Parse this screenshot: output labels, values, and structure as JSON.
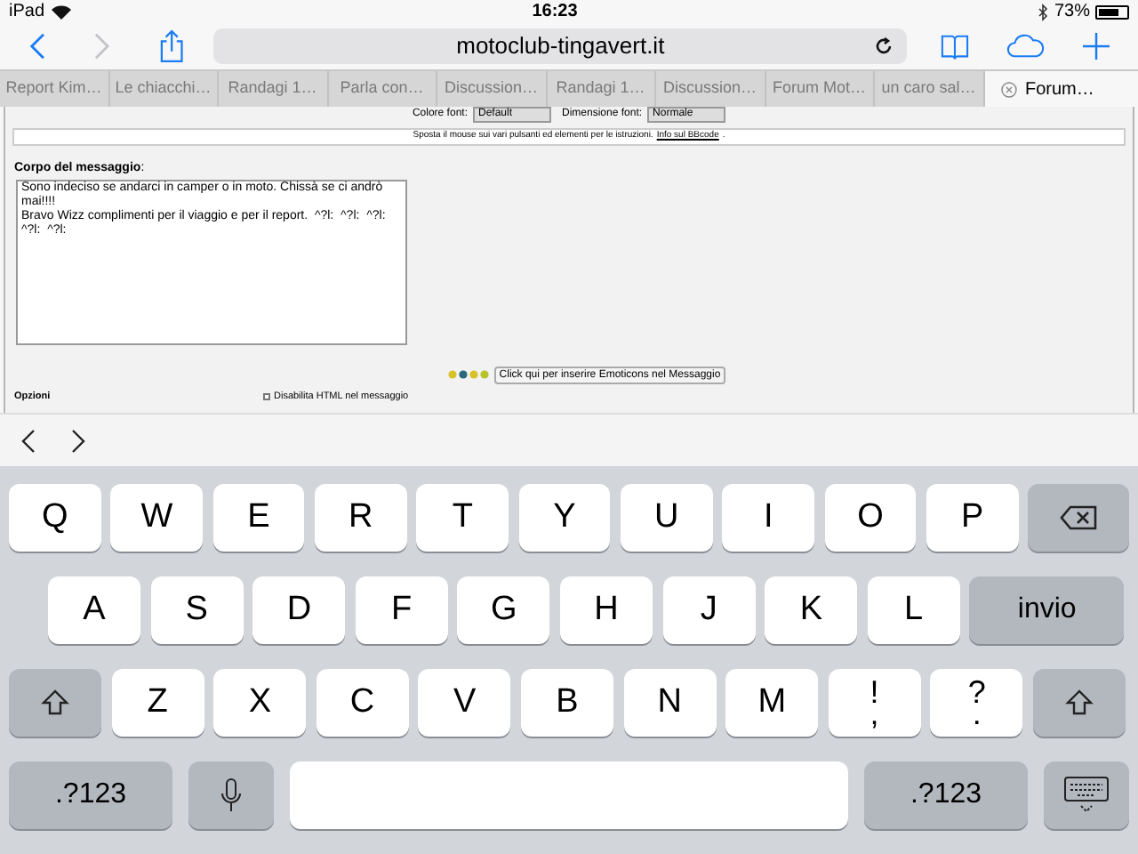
{
  "status_bar": {
    "device": "iPad",
    "time": "16:23",
    "battery": "73%"
  },
  "address_bar": {
    "url": "motoclub-tingavert.it"
  },
  "tabs": [
    {
      "label": "Report Kim…",
      "selected": false
    },
    {
      "label": "Le chiacchi…",
      "selected": false
    },
    {
      "label": "Randagi 1…",
      "selected": false
    },
    {
      "label": "Parla con…",
      "selected": false
    },
    {
      "label": "Discussion…",
      "selected": false
    },
    {
      "label": "Randagi 1…",
      "selected": false
    },
    {
      "label": "Discussion…",
      "selected": false
    },
    {
      "label": "Forum Mot…",
      "selected": false
    },
    {
      "label": "un caro sal…",
      "selected": false
    },
    {
      "label": "Forum…",
      "selected": true
    }
  ],
  "page": {
    "font_settings": [
      {
        "label": "Colore font:",
        "value": "Default"
      },
      {
        "label": "Dimensione font:",
        "value": "Normale"
      }
    ],
    "hint": "Sposta il mouse sui vari pulsanti ed elementi per le istruzioni.",
    "hint_link": "Info sul BBcode",
    "hint_end": ".",
    "body_label": "Corpo del messaggio",
    "body_colon": ":",
    "message": "Sono indeciso se andarci in camper o in moto. Chissà se ci andrò mai!!!!\nBravo Wizz complimenti per il viaggio e per il report.  ^?l:  ^?l:  ^?l:  ^?l:  ^?l:",
    "emoticon_button": "Click qui per inserire Emoticons nel Messaggio",
    "options_label": "Opzioni",
    "options": [
      {
        "label": "Disabilita HTML nel messaggio",
        "checked": false
      }
    ]
  },
  "keyboard": {
    "rows": [
      {
        "keys": [
          {
            "kind": "letter",
            "label": "Q"
          },
          {
            "kind": "letter",
            "label": "W"
          },
          {
            "kind": "letter",
            "label": "E"
          },
          {
            "kind": "letter",
            "label": "R"
          },
          {
            "kind": "letter",
            "label": "T"
          },
          {
            "kind": "letter",
            "label": "Y"
          },
          {
            "kind": "letter",
            "label": "U"
          },
          {
            "kind": "letter",
            "label": "I"
          },
          {
            "kind": "letter",
            "label": "O"
          },
          {
            "kind": "letter",
            "label": "P"
          },
          {
            "kind": "backspace"
          }
        ]
      },
      {
        "keys": [
          {
            "kind": "letter",
            "label": "A"
          },
          {
            "kind": "letter",
            "label": "S"
          },
          {
            "kind": "letter",
            "label": "D"
          },
          {
            "kind": "letter",
            "label": "F"
          },
          {
            "kind": "letter",
            "label": "G"
          },
          {
            "kind": "letter",
            "label": "H"
          },
          {
            "kind": "letter",
            "label": "J"
          },
          {
            "kind": "letter",
            "label": "K"
          },
          {
            "kind": "letter",
            "label": "L"
          },
          {
            "kind": "return",
            "label": "invio"
          }
        ]
      },
      {
        "keys": [
          {
            "kind": "shift"
          },
          {
            "kind": "letter",
            "label": "Z"
          },
          {
            "kind": "letter",
            "label": "X"
          },
          {
            "kind": "letter",
            "label": "C"
          },
          {
            "kind": "letter",
            "label": "V"
          },
          {
            "kind": "letter",
            "label": "B"
          },
          {
            "kind": "letter",
            "label": "N"
          },
          {
            "kind": "letter",
            "label": "M"
          },
          {
            "kind": "punct",
            "label": "!",
            "sub": ","
          },
          {
            "kind": "punct",
            "label": "?",
            "sub": "."
          },
          {
            "kind": "shift"
          }
        ]
      },
      {
        "keys": [
          {
            "kind": "symbols",
            "label": ".?123"
          },
          {
            "kind": "mic"
          },
          {
            "kind": "space"
          },
          {
            "kind": "symbols",
            "label": ".?123"
          },
          {
            "kind": "hide"
          }
        ]
      }
    ]
  }
}
